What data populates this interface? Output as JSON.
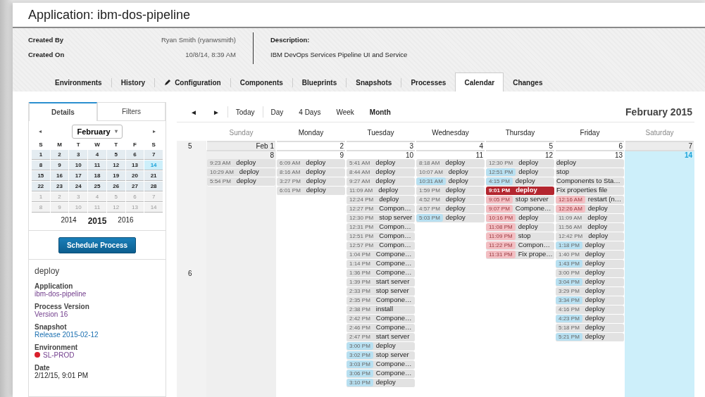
{
  "page_title": "Application: ibm-dos-pipeline",
  "info": {
    "fields": [
      {
        "label": "Created By",
        "value": "Ryan Smith (ryanwsmith)"
      },
      {
        "label": "Created On",
        "value": "10/8/14, 8:39 AM"
      }
    ],
    "description": {
      "label": "Description:",
      "value": "IBM DevOps Services Pipeline UI and Service"
    }
  },
  "tabs": [
    {
      "label": "Environments",
      "selected": false,
      "icon": false
    },
    {
      "label": "History",
      "selected": false,
      "icon": false
    },
    {
      "label": "Configuration",
      "selected": false,
      "icon": true
    },
    {
      "label": "Components",
      "selected": false,
      "icon": false
    },
    {
      "label": "Blueprints",
      "selected": false,
      "icon": false
    },
    {
      "label": "Snapshots",
      "selected": false,
      "icon": false
    },
    {
      "label": "Processes",
      "selected": false,
      "icon": false
    },
    {
      "label": "Calendar",
      "selected": true,
      "icon": false
    },
    {
      "label": "Changes",
      "selected": false,
      "icon": false
    }
  ],
  "side_tabs": [
    {
      "label": "Details",
      "selected": true
    },
    {
      "label": "Filters",
      "selected": false
    }
  ],
  "mini_calendar": {
    "prev": "◂",
    "next": "▸",
    "month": "February",
    "caret": "▾",
    "weekdays": [
      "S",
      "M",
      "T",
      "W",
      "T",
      "F",
      "S"
    ],
    "weeks": [
      [
        {
          "day": "1",
          "in_month": true,
          "selected": false
        },
        {
          "day": "2",
          "in_month": true,
          "selected": false
        },
        {
          "day": "3",
          "in_month": true,
          "selected": false
        },
        {
          "day": "4",
          "in_month": true,
          "selected": false
        },
        {
          "day": "5",
          "in_month": true,
          "selected": false
        },
        {
          "day": "6",
          "in_month": true,
          "selected": false
        },
        {
          "day": "7",
          "in_month": true,
          "selected": false
        }
      ],
      [
        {
          "day": "8",
          "in_month": true,
          "selected": false
        },
        {
          "day": "9",
          "in_month": true,
          "selected": false
        },
        {
          "day": "10",
          "in_month": true,
          "selected": false
        },
        {
          "day": "11",
          "in_month": true,
          "selected": false
        },
        {
          "day": "12",
          "in_month": true,
          "selected": false
        },
        {
          "day": "13",
          "in_month": true,
          "selected": false
        },
        {
          "day": "14",
          "in_month": true,
          "selected": true
        }
      ],
      [
        {
          "day": "15",
          "in_month": true,
          "selected": false
        },
        {
          "day": "16",
          "in_month": true,
          "selected": false
        },
        {
          "day": "17",
          "in_month": true,
          "selected": false
        },
        {
          "day": "18",
          "in_month": true,
          "selected": false
        },
        {
          "day": "19",
          "in_month": true,
          "selected": false
        },
        {
          "day": "20",
          "in_month": true,
          "selected": false
        },
        {
          "day": "21",
          "in_month": true,
          "selected": false
        }
      ],
      [
        {
          "day": "22",
          "in_month": true,
          "selected": false
        },
        {
          "day": "23",
          "in_month": true,
          "selected": false
        },
        {
          "day": "24",
          "in_month": true,
          "selected": false
        },
        {
          "day": "25",
          "in_month": true,
          "selected": false
        },
        {
          "day": "26",
          "in_month": true,
          "selected": false
        },
        {
          "day": "27",
          "in_month": true,
          "selected": false
        },
        {
          "day": "28",
          "in_month": true,
          "selected": false
        }
      ],
      [
        {
          "day": "1",
          "in_month": false,
          "selected": false
        },
        {
          "day": "2",
          "in_month": false,
          "selected": false
        },
        {
          "day": "3",
          "in_month": false,
          "selected": false
        },
        {
          "day": "4",
          "in_month": false,
          "selected": false
        },
        {
          "day": "5",
          "in_month": false,
          "selected": false
        },
        {
          "day": "6",
          "in_month": false,
          "selected": false
        },
        {
          "day": "7",
          "in_month": false,
          "selected": false
        }
      ],
      [
        {
          "day": "8",
          "in_month": false,
          "selected": false
        },
        {
          "day": "9",
          "in_month": false,
          "selected": false
        },
        {
          "day": "10",
          "in_month": false,
          "selected": false
        },
        {
          "day": "11",
          "in_month": false,
          "selected": false
        },
        {
          "day": "12",
          "in_month": false,
          "selected": false
        },
        {
          "day": "13",
          "in_month": false,
          "selected": false
        },
        {
          "day": "14",
          "in_month": false,
          "selected": false
        }
      ]
    ],
    "years": [
      {
        "label": "2014",
        "selected": false
      },
      {
        "label": "2015",
        "selected": true
      },
      {
        "label": "2016",
        "selected": false
      }
    ]
  },
  "schedule_button": "Schedule Process",
  "details": {
    "title": "deploy",
    "fields": [
      {
        "label": "Application",
        "value": "ibm-dos-pipeline",
        "kind": "link",
        "visited": true
      },
      {
        "label": "Process Version",
        "value": "Version 16",
        "kind": "link",
        "visited": true
      },
      {
        "label": "Snapshot",
        "value": "Release 2015-02-12",
        "kind": "link",
        "visited": false
      },
      {
        "label": "Environment",
        "value": "SL-PROD",
        "kind": "environment",
        "visited": true,
        "color": "#d9202c"
      },
      {
        "label": "Date",
        "value": "2/12/15, 9:01 PM",
        "kind": "text"
      }
    ]
  },
  "toolbar": {
    "prev": "◄",
    "next": "►",
    "today": "Today",
    "views": [
      {
        "label": "Day",
        "selected": false
      },
      {
        "label": "4 Days",
        "selected": false
      },
      {
        "label": "Week",
        "selected": false
      },
      {
        "label": "Month",
        "selected": true
      }
    ],
    "title": "February 2015"
  },
  "calendar": {
    "day_names": [
      "Sunday",
      "Monday",
      "Tuesday",
      "Wednesday",
      "Thursday",
      "Friday",
      "Saturday"
    ],
    "weeks": [
      {
        "number": "5",
        "days": [
          {
            "date": "Feb 1",
            "today": false
          },
          {
            "date": "2",
            "today": false
          },
          {
            "date": "3",
            "today": false
          },
          {
            "date": "4",
            "today": false
          },
          {
            "date": "5",
            "today": false
          },
          {
            "date": "6",
            "today": false
          },
          {
            "date": "7",
            "today": false
          }
        ]
      },
      {
        "number": "6",
        "days": [
          {
            "date": "8",
            "today": false,
            "events": [
              {
                "time": "9:23 AM",
                "title": "deploy",
                "kind": "plain",
                "selected": false
              },
              {
                "time": "10:29 AM",
                "title": "deploy",
                "kind": "plain",
                "selected": false
              },
              {
                "time": "5:54 PM",
                "title": "deploy",
                "kind": "plain",
                "selected": false
              }
            ]
          },
          {
            "date": "9",
            "today": false,
            "events": [
              {
                "time": "6:09 AM",
                "title": "deploy",
                "kind": "plain",
                "selected": false
              },
              {
                "time": "8:16 AM",
                "title": "deploy",
                "kind": "plain",
                "selected": false
              },
              {
                "time": "3:27 PM",
                "title": "deploy",
                "kind": "plain",
                "selected": false
              },
              {
                "time": "6:01 PM",
                "title": "deploy",
                "kind": "plain",
                "selected": false
              }
            ]
          },
          {
            "date": "10",
            "today": false,
            "events": [
              {
                "time": "5:41 AM",
                "title": "deploy",
                "kind": "plain",
                "selected": false
              },
              {
                "time": "8:44 AM",
                "title": "deploy",
                "kind": "plain",
                "selected": false
              },
              {
                "time": "9:27 AM",
                "title": "deploy",
                "kind": "plain",
                "selected": false
              },
              {
                "time": "11:09 AM",
                "title": "deploy",
                "kind": "plain",
                "selected": false
              },
              {
                "time": "12:24 PM",
                "title": "deploy",
                "kind": "plain",
                "selected": false
              },
              {
                "time": "12:27 PM",
                "title": "Compon…",
                "kind": "plain",
                "selected": false
              },
              {
                "time": "12:30 PM",
                "title": "stop server",
                "kind": "plain",
                "selected": false
              },
              {
                "time": "12:31 PM",
                "title": "Compon…",
                "kind": "plain",
                "selected": false
              },
              {
                "time": "12:51 PM",
                "title": "Compon…",
                "kind": "plain",
                "selected": false
              },
              {
                "time": "12:57 PM",
                "title": "Compon…",
                "kind": "plain",
                "selected": false
              },
              {
                "time": "1:04 PM",
                "title": "Compone…",
                "kind": "plain",
                "selected": false
              },
              {
                "time": "1:14 PM",
                "title": "Compone…",
                "kind": "plain",
                "selected": false
              },
              {
                "time": "1:36 PM",
                "title": "Compone…",
                "kind": "plain",
                "selected": false
              },
              {
                "time": "1:39 PM",
                "title": "start server",
                "kind": "plain",
                "selected": false
              },
              {
                "time": "2:33 PM",
                "title": "stop server",
                "kind": "plain",
                "selected": false
              },
              {
                "time": "2:35 PM",
                "title": "Compone…",
                "kind": "plain",
                "selected": false
              },
              {
                "time": "2:38 PM",
                "title": "install",
                "kind": "plain",
                "selected": false
              },
              {
                "time": "2:42 PM",
                "title": "Compone…",
                "kind": "plain",
                "selected": false
              },
              {
                "time": "2:46 PM",
                "title": "Compone…",
                "kind": "plain",
                "selected": false
              },
              {
                "time": "2:47 PM",
                "title": "start server",
                "kind": "plain",
                "selected": false
              },
              {
                "time": "3:00 PM",
                "title": "deploy",
                "kind": "info",
                "selected": false
              },
              {
                "time": "3:02 PM",
                "title": "stop server",
                "kind": "info",
                "selected": false
              },
              {
                "time": "3:03 PM",
                "title": "Compone…",
                "kind": "info",
                "selected": false
              },
              {
                "time": "3:06 PM",
                "title": "Compone…",
                "kind": "info",
                "selected": false
              },
              {
                "time": "3:10 PM",
                "title": "deploy",
                "kind": "info",
                "selected": false
              }
            ]
          },
          {
            "date": "11",
            "today": false,
            "events": [
              {
                "time": "8:18 AM",
                "title": "deploy",
                "kind": "plain",
                "selected": false
              },
              {
                "time": "10:07 AM",
                "title": "deploy",
                "kind": "plain",
                "selected": false
              },
              {
                "time": "10:31 AM",
                "title": "deploy",
                "kind": "info",
                "selected": false
              },
              {
                "time": "1:59 PM",
                "title": "deploy",
                "kind": "plain",
                "selected": false
              },
              {
                "time": "4:52 PM",
                "title": "deploy",
                "kind": "plain",
                "selected": false
              },
              {
                "time": "4:57 PM",
                "title": "deploy",
                "kind": "plain",
                "selected": false
              },
              {
                "time": "5:03 PM",
                "title": "deploy",
                "kind": "info",
                "selected": false
              }
            ]
          },
          {
            "date": "12",
            "today": false,
            "events": [
              {
                "time": "12:30 PM",
                "title": "deploy",
                "kind": "plain",
                "selected": false
              },
              {
                "time": "12:51 PM",
                "title": "deploy",
                "kind": "info",
                "selected": false
              },
              {
                "time": "4:15 PM",
                "title": "deploy",
                "kind": "info",
                "selected": false
              },
              {
                "time": "9:01 PM",
                "title": "deploy",
                "kind": "failed",
                "selected": true
              },
              {
                "time": "9:05 PM",
                "title": "stop server",
                "kind": "failed",
                "selected": false
              },
              {
                "time": "9:07 PM",
                "title": "Compone…",
                "kind": "failed",
                "selected": false
              },
              {
                "time": "10:16 PM",
                "title": "deploy",
                "kind": "failed",
                "selected": false
              },
              {
                "time": "11:08 PM",
                "title": "deploy",
                "kind": "failed",
                "selected": false
              },
              {
                "time": "11:09 PM",
                "title": "stop",
                "kind": "failed",
                "selected": false
              },
              {
                "time": "11:22 PM",
                "title": "Compon…",
                "kind": "failed",
                "selected": false
              },
              {
                "time": "11:31 PM",
                "title": "Fix prope…",
                "kind": "failed",
                "selected": false
              }
            ]
          },
          {
            "date": "13",
            "today": false,
            "events": [
              {
                "title": "deploy",
                "kind": "untimed",
                "selected": false
              },
              {
                "title": "stop",
                "kind": "untimed",
                "selected": false
              },
              {
                "title": "Components to Sta…",
                "kind": "untimed",
                "selected": false
              },
              {
                "title": "Fix properties file",
                "kind": "untimed",
                "selected": false
              },
              {
                "time": "12:16 AM",
                "title": "restart (n…",
                "kind": "failed",
                "selected": false
              },
              {
                "time": "12:26 AM",
                "title": "deploy",
                "kind": "failed",
                "selected": false
              },
              {
                "time": "11:09 AM",
                "title": "deploy",
                "kind": "plain",
                "selected": false
              },
              {
                "time": "11:56 AM",
                "title": "deploy",
                "kind": "plain",
                "selected": false
              },
              {
                "time": "12:42 PM",
                "title": "deploy",
                "kind": "plain",
                "selected": false
              },
              {
                "time": "1:18 PM",
                "title": "deploy",
                "kind": "info",
                "selected": false
              },
              {
                "time": "1:40 PM",
                "title": "deploy",
                "kind": "plain",
                "selected": false
              },
              {
                "time": "1:43 PM",
                "title": "deploy",
                "kind": "info",
                "selected": false
              },
              {
                "time": "3:00 PM",
                "title": "deploy",
                "kind": "plain",
                "selected": false
              },
              {
                "time": "3:04 PM",
                "title": "deploy",
                "kind": "info",
                "selected": false
              },
              {
                "time": "3:29 PM",
                "title": "deploy",
                "kind": "plain",
                "selected": false
              },
              {
                "time": "3:34 PM",
                "title": "deploy",
                "kind": "info",
                "selected": false
              },
              {
                "time": "4:16 PM",
                "title": "deploy",
                "kind": "plain",
                "selected": false
              },
              {
                "time": "4:23 PM",
                "title": "deploy",
                "kind": "info",
                "selected": false
              },
              {
                "time": "5:18 PM",
                "title": "deploy",
                "kind": "plain",
                "selected": false
              },
              {
                "time": "5:21 PM",
                "title": "deploy",
                "kind": "info",
                "selected": false
              }
            ]
          },
          {
            "date": "14",
            "today": true
          }
        ]
      }
    ]
  }
}
